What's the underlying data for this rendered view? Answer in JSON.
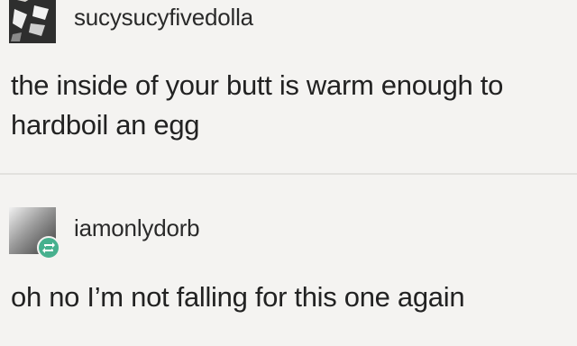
{
  "posts": [
    {
      "username": "sucysucyfivedolla",
      "text": "the inside of your butt is warm enough to hardboil an egg",
      "avatar_icon": "user-avatar-icon"
    },
    {
      "username": "iamonlydorb",
      "text": "oh no I’m not falling for this one again",
      "avatar_icon": "user-avatar-icon",
      "badge_icon": "reblog-icon"
    }
  ],
  "colors": {
    "background": "#f4f3f1",
    "text": "#222222",
    "reblog_badge": "#47b08e"
  }
}
